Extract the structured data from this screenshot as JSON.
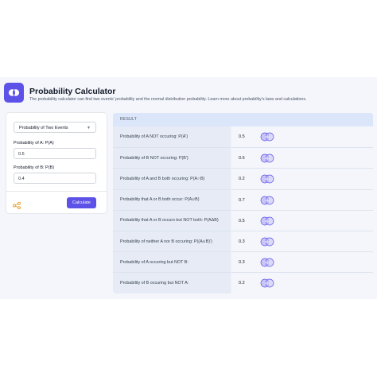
{
  "header": {
    "title": "Probability Calculator",
    "subtitle": "The probability calculator can find two events' probability and the normal distribution probability. Learn more about probability's laws and calculations."
  },
  "form": {
    "mode": "Probability of Two Events",
    "label_a": "Probability of A: P(A)",
    "value_a": "0.5",
    "label_b": "Probability of B: P(B)",
    "value_b": "0.4",
    "calculate_label": "Calculate"
  },
  "result": {
    "header": "RESULT",
    "rows": [
      {
        "label": "Probability of A NOT occuring: P(A')",
        "value": "0.5",
        "venn": "A B"
      },
      {
        "label": "Probability of B NOT occuring: P(B')",
        "value": "0.6",
        "venn": "A B"
      },
      {
        "label": "Probability of A and B both occuring: P(A∩B)",
        "value": "0.2",
        "venn": "A B"
      },
      {
        "label": "Probability that A or B both occur: P(A∪B)",
        "value": "0.7",
        "venn": "A B"
      },
      {
        "label": "Probability that A or B occurs but NOT both: P(AΔB)",
        "value": "0.5",
        "venn": "A B"
      },
      {
        "label": "Probability of neither A nor B occuring: P((A∪B)')",
        "value": "0.3",
        "venn": "A B"
      },
      {
        "label": "Probability of A occuring but NOT B:",
        "value": "0.3",
        "venn": "A B"
      },
      {
        "label": "Probability of B occuring but NOT A:",
        "value": "0.2",
        "venn": "A B"
      }
    ]
  },
  "colors": {
    "accent": "#5d52e8",
    "venn_fill": "#c9c6f7"
  }
}
